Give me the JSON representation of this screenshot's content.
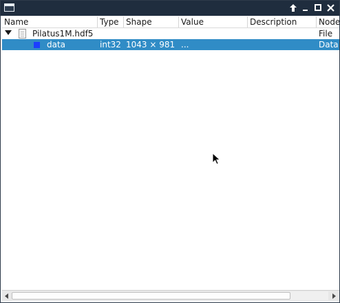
{
  "window": {
    "title": "",
    "buttons": {
      "keep_above_glyph": "↑",
      "minimize_glyph": "_",
      "maximize_glyph": "□",
      "close_glyph": "✕"
    }
  },
  "table": {
    "columns": [
      "Name",
      "Type",
      "Shape",
      "Value",
      "Description",
      "Node"
    ],
    "rows": [
      {
        "name": "Pilatus1M.hdf5",
        "type": "",
        "shape": "",
        "value": "",
        "description": "",
        "node": "File",
        "icon": "file-icon",
        "expanded": true,
        "selected": false
      },
      {
        "name": "data",
        "type": "int32",
        "shape": "1043 × 981",
        "value": "...",
        "description": "",
        "node": "Data",
        "icon": "dataset-icon",
        "selected": true
      }
    ]
  },
  "colors": {
    "titlebar": "#1f2d3e",
    "selection": "#308cc6",
    "dataset_icon": "#1c3fff"
  }
}
